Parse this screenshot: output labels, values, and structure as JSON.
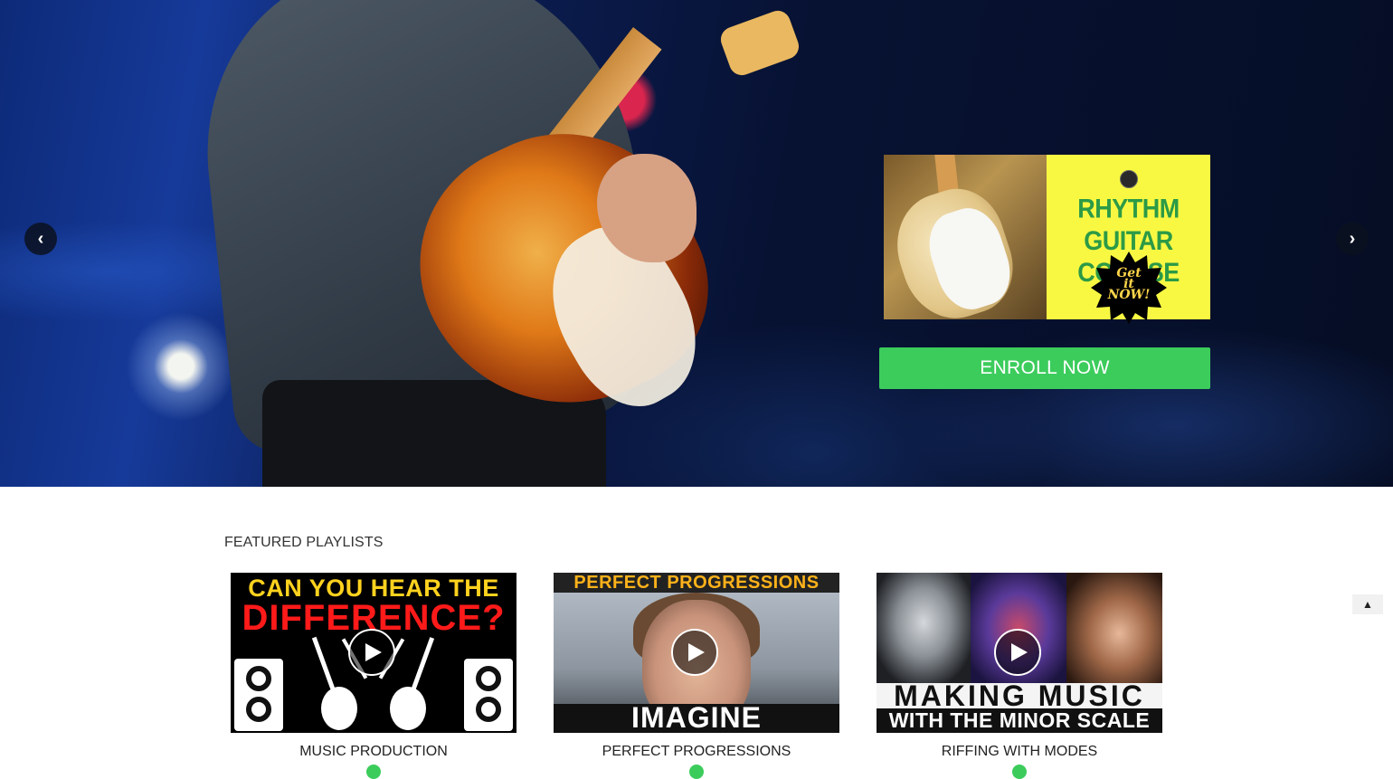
{
  "hero": {
    "prev_arrow": "‹",
    "next_arrow": "›",
    "promo": {
      "title_line1": "RHYTHM",
      "title_line2": "GUITAR COURSE",
      "burst_line1": "Get",
      "burst_line2": "it",
      "burst_line3": "NOW!"
    },
    "enroll_label": "ENROLL NOW"
  },
  "featured": {
    "title": "FEATURED PLAYLISTS",
    "cards": [
      {
        "label": "MUSIC PRODUCTION",
        "thumb_line1": "CAN YOU HEAR THE",
        "thumb_line2": "DIFFERENCE?"
      },
      {
        "label": "PERFECT PROGRESSIONS",
        "thumb_line1": "PERFECT PROGRESSIONS",
        "thumb_line2": "IMAGINE"
      },
      {
        "label": "RIFFING WITH MODES",
        "thumb_line1": "MAKING MUSIC",
        "thumb_line2": "WITH THE MINOR SCALE"
      }
    ]
  },
  "scroll_top": "▲",
  "colors": {
    "accent_green": "#3ccc5c",
    "promo_yellow": "#f8f843",
    "promo_text_green": "#2c9a46"
  }
}
